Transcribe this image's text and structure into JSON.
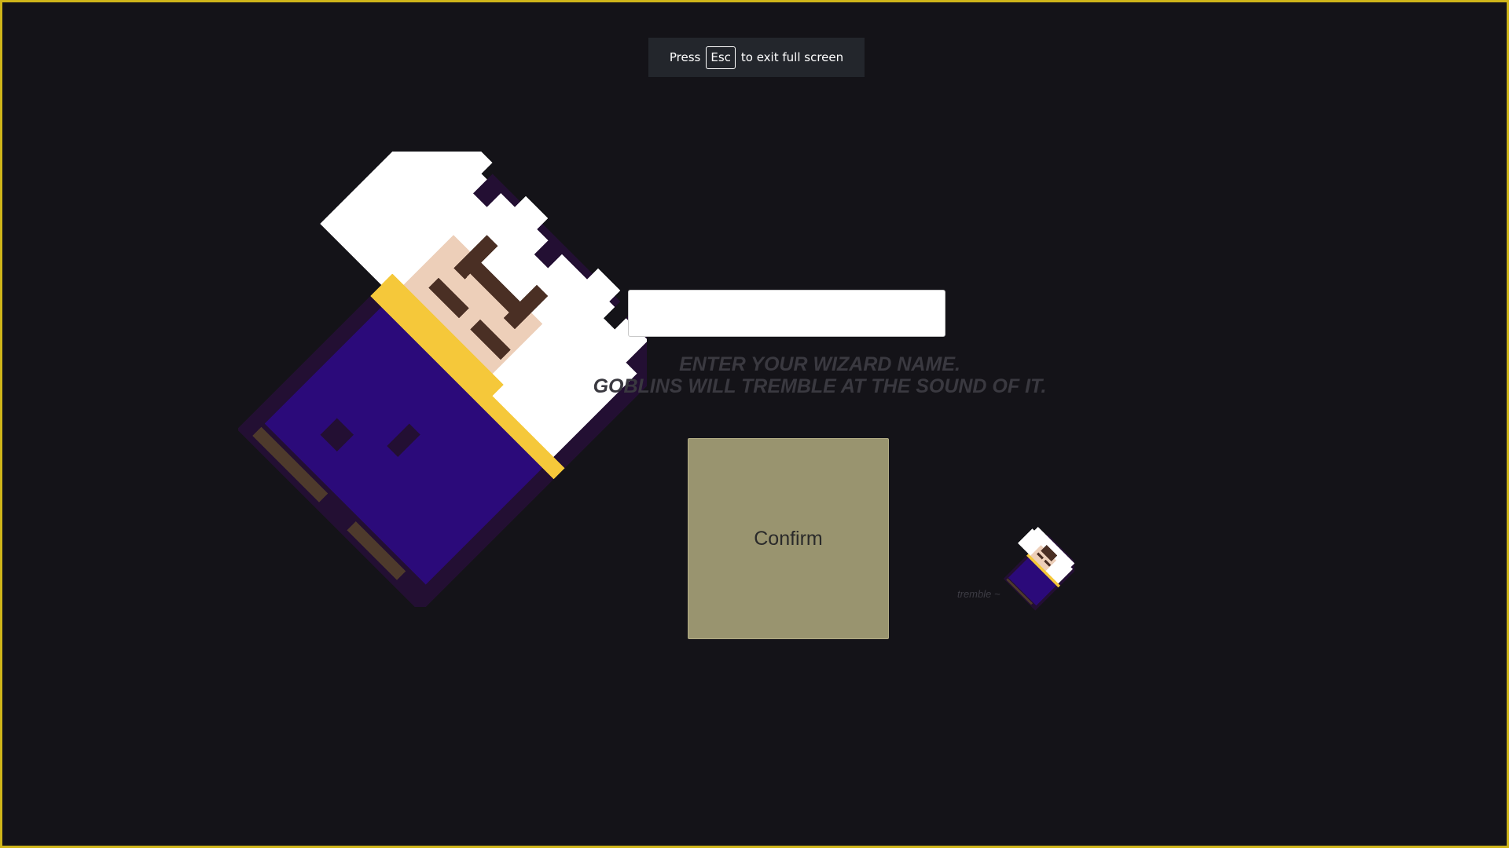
{
  "fullscreen_notice": {
    "prefix": "Press",
    "key": "Esc",
    "suffix": "to exit full screen"
  },
  "name_input": {
    "value": "",
    "placeholder": ""
  },
  "prompt": {
    "line1": "ENTER YOUR WIZARD NAME.",
    "line2": "GOBLINS WILL TREMBLE AT THE SOUND OF IT."
  },
  "confirm_label": "Confirm",
  "tremble_label": "tremble ~",
  "colors": {
    "frame_border": "#cfb51a",
    "background": "#141318",
    "robe_dark": "#230f33",
    "robe": "#2b0a7a",
    "beard": "#ffffff",
    "skin": "#edcfb9",
    "gold": "#f5c83a",
    "eyes": "#4a2f24",
    "staff": "#4e3a2c",
    "confirm_bg": "#99946f"
  }
}
